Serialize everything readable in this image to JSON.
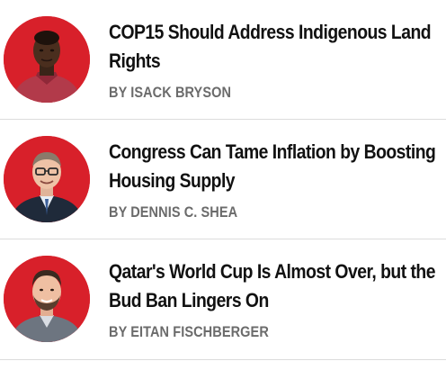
{
  "articles": [
    {
      "headline": "COP15 Should Address Indigenous Land Rights",
      "byline": "BY ISACK BRYSON",
      "avatar_alt": "Isack Bryson"
    },
    {
      "headline": "Congress Can Tame Inflation by Boosting Housing Supply",
      "byline": "BY DENNIS C. SHEA",
      "avatar_alt": "Dennis C. Shea"
    },
    {
      "headline": "Qatar's World Cup Is Almost Over, but the Bud Ban Lingers On",
      "byline": "BY EITAN FISCHBERGER",
      "avatar_alt": "Eitan Fischberger"
    }
  ],
  "colors": {
    "avatar_background": "#d8202a",
    "headline": "#111111",
    "byline": "#6b6b6b",
    "divider": "#dcdcdc"
  }
}
